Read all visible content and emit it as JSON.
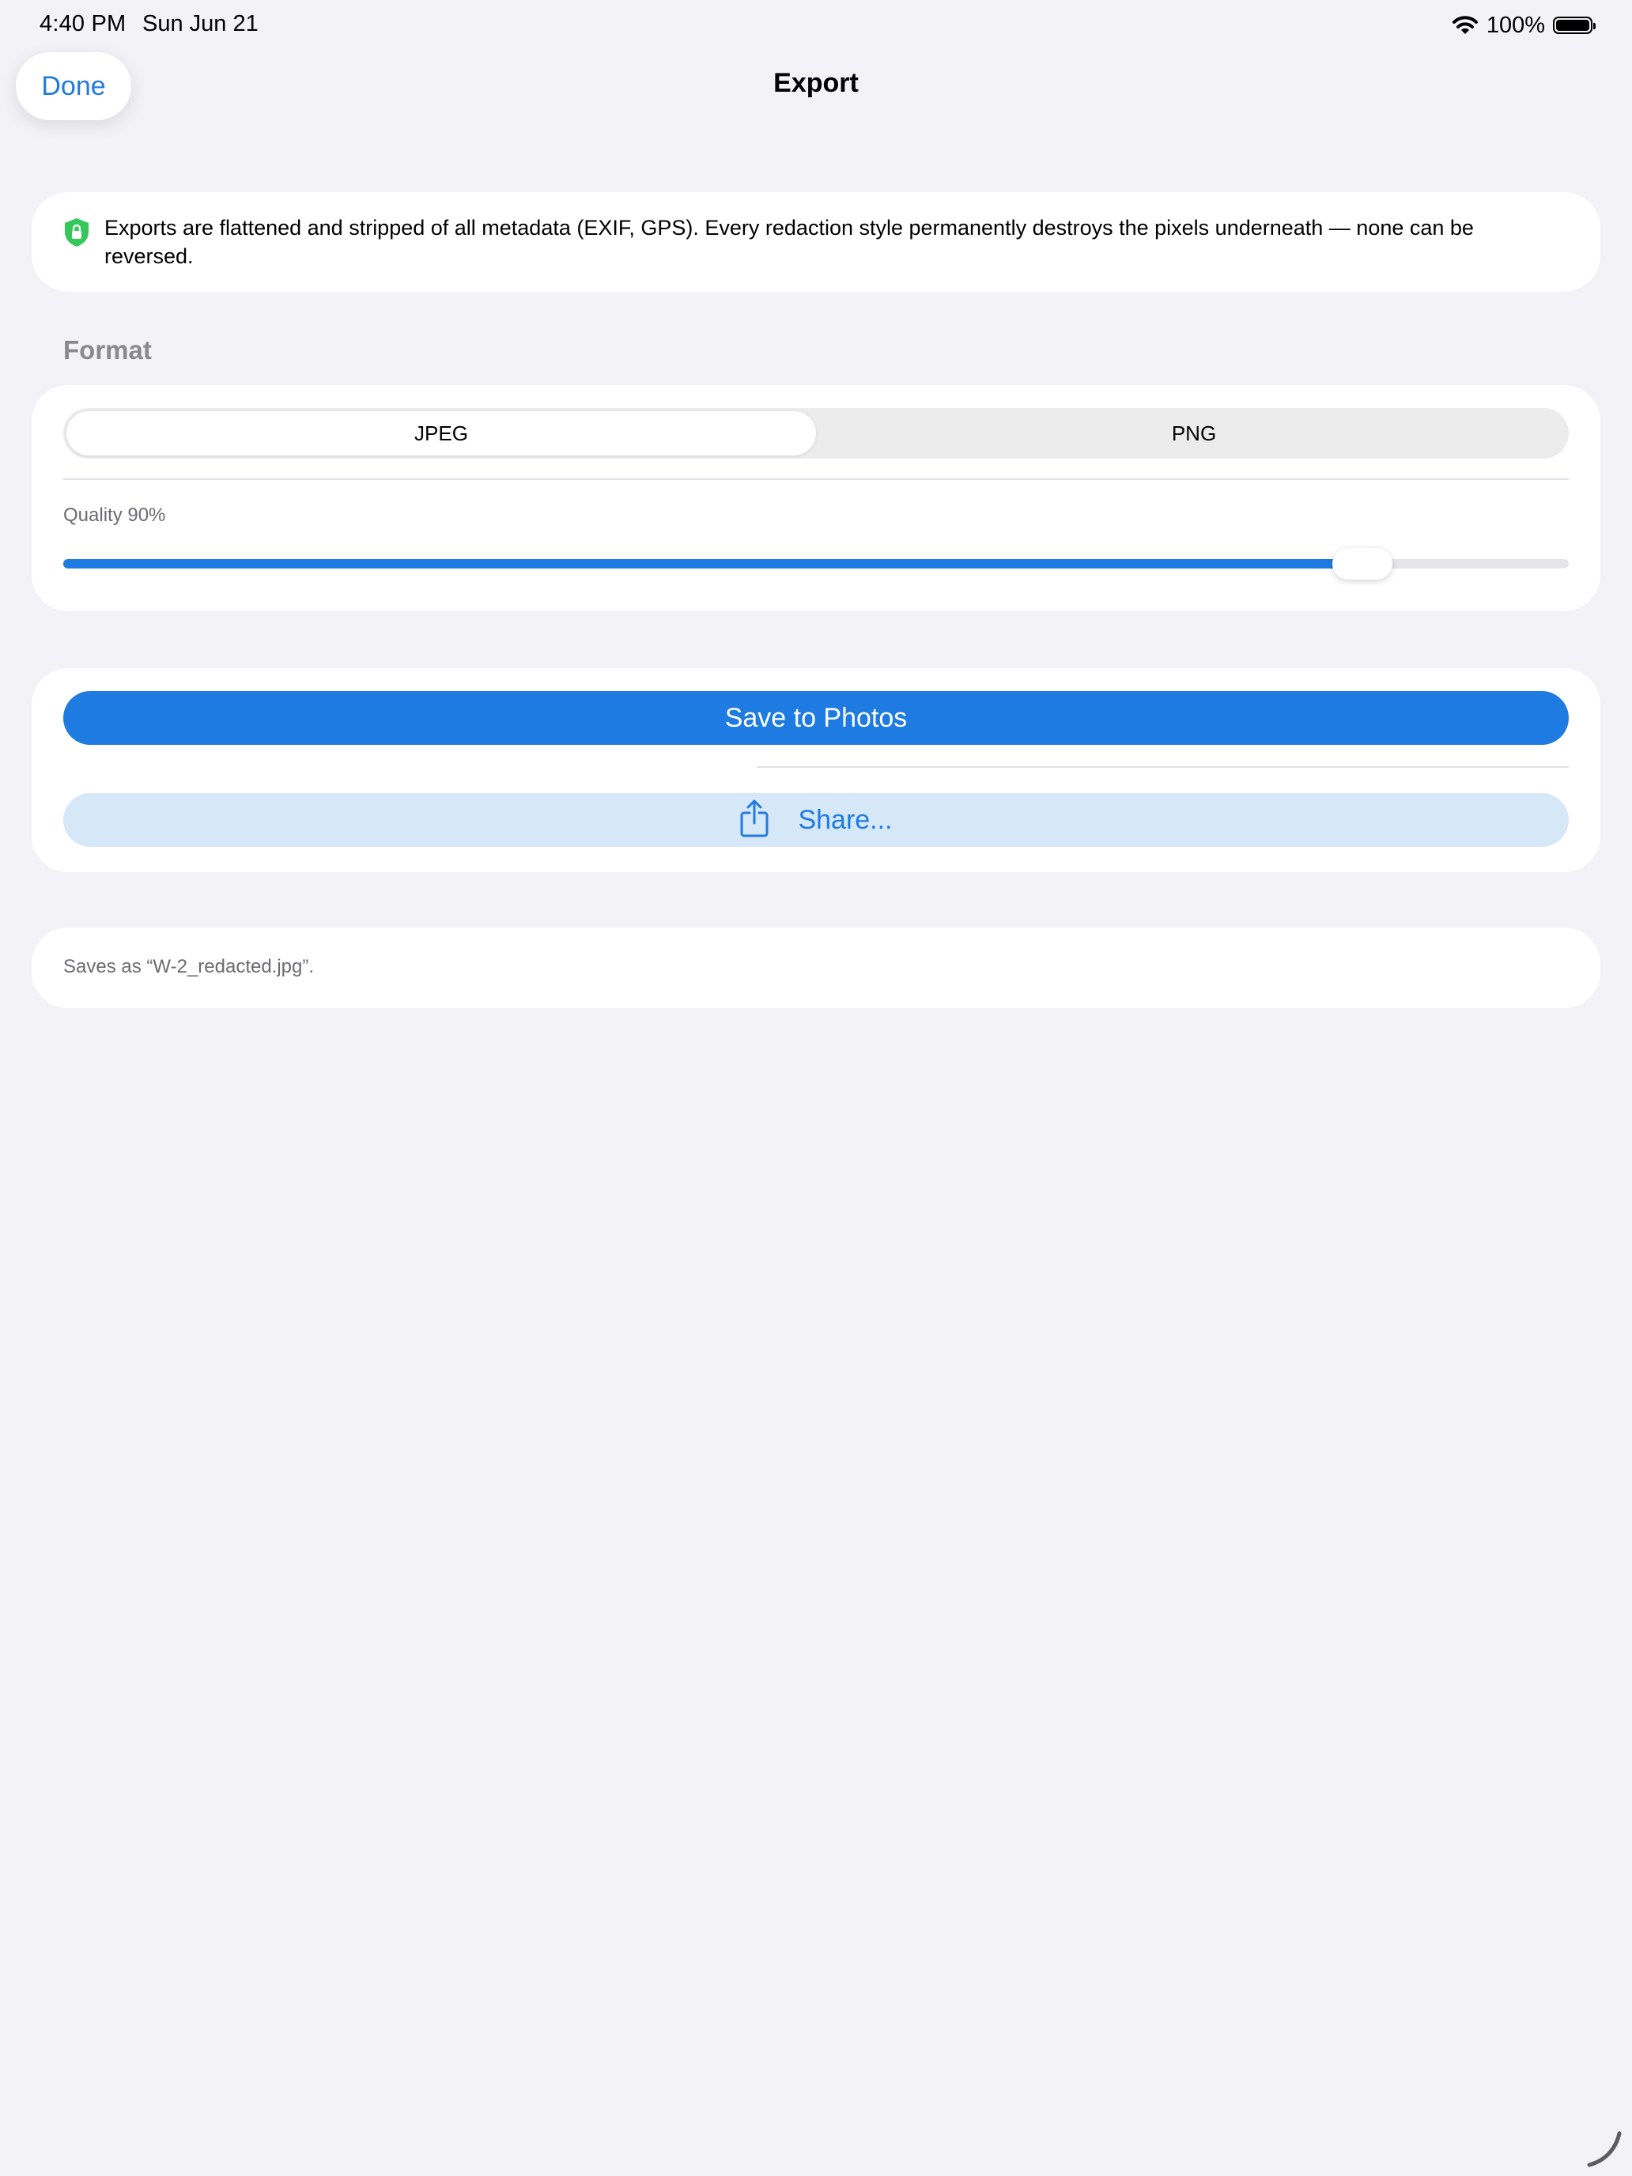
{
  "status_bar": {
    "time": "4:40 PM",
    "date": "Sun Jun 21",
    "battery_percent": "100%",
    "battery_level": 1.0
  },
  "nav": {
    "done_label": "Done",
    "title": "Export"
  },
  "info": {
    "icon": "shield-lock-icon",
    "icon_color": "#34c759",
    "text": "Exports are flattened and stripped of all metadata (EXIF, GPS). Every redaction style permanently destroys the pixels underneath — none can be reversed."
  },
  "format": {
    "section_label": "Format",
    "options": [
      "JPEG",
      "PNG"
    ],
    "selected": "JPEG",
    "quality_label": "Quality 90%",
    "quality_value": 0.9
  },
  "actions": {
    "save_label": "Save to Photos",
    "share_label": "Share...",
    "accent_color": "#1e7be2"
  },
  "footer": {
    "filename_note": "Saves as “W-2_redacted.jpg”."
  }
}
